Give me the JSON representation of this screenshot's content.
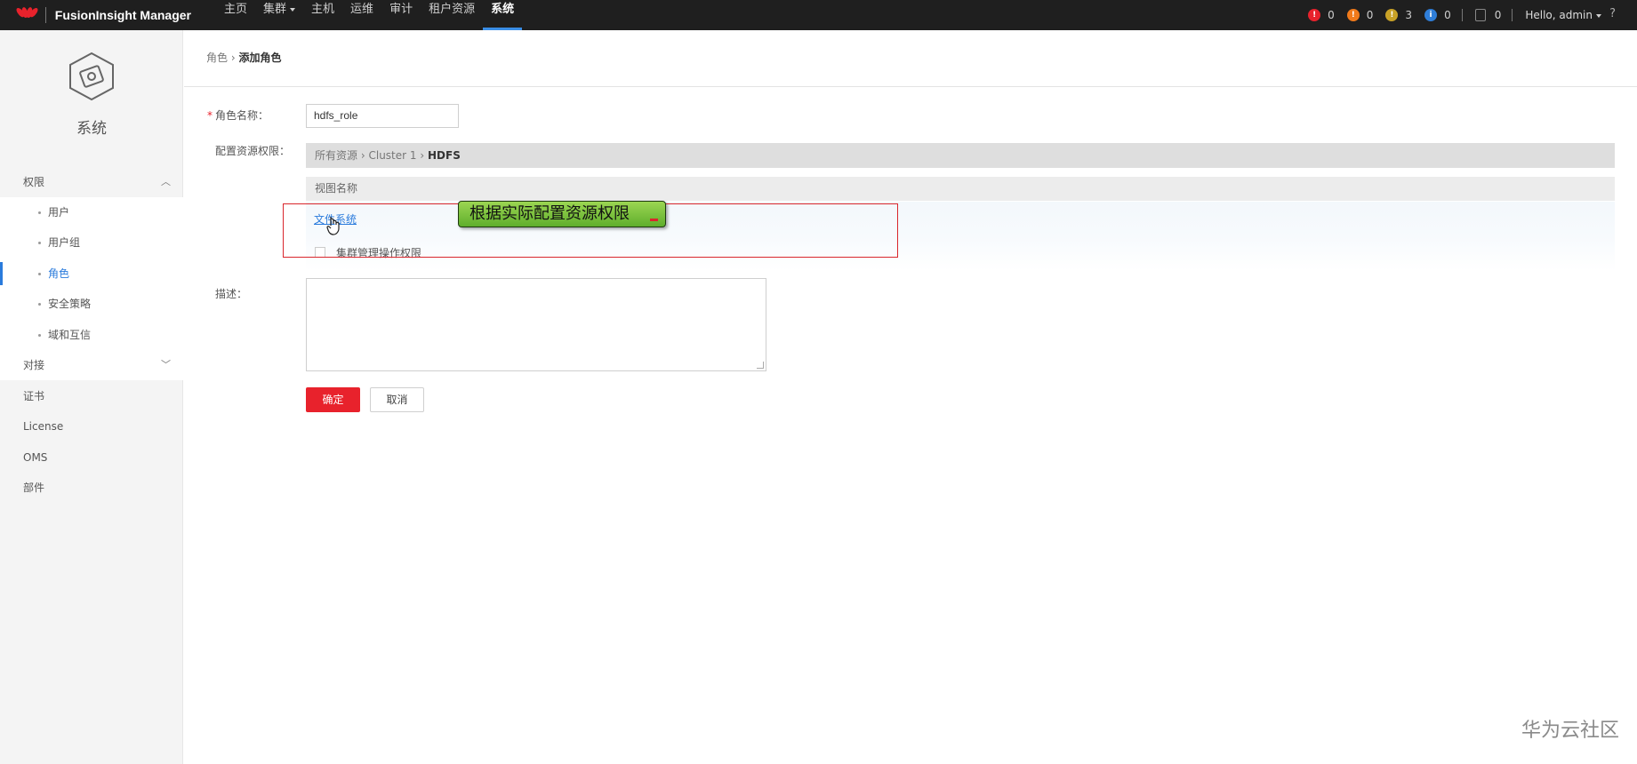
{
  "app": {
    "brand_small": "HUAWEI",
    "title": "FusionInsight Manager"
  },
  "nav": {
    "items": [
      {
        "label": "主页"
      },
      {
        "label": "集群"
      },
      {
        "label": "主机"
      },
      {
        "label": "运维"
      },
      {
        "label": "审计"
      },
      {
        "label": "租户资源"
      },
      {
        "label": "系统"
      }
    ],
    "active": "系统"
  },
  "alarms": {
    "critical": "0",
    "major": "0",
    "minor": "3",
    "warning": "0",
    "tasks": "0",
    "colors": {
      "critical": "#e8222c",
      "major": "#f07a1a",
      "minor": "#c9a227",
      "warning": "#2f7ed8"
    }
  },
  "user": {
    "greeting": "Hello, admin",
    "help": "?"
  },
  "sidebar": {
    "title": "系统",
    "groups": [
      {
        "label": "权限",
        "expanded": true
      },
      {
        "label": "对接",
        "expanded": false
      }
    ],
    "permission_items": [
      "用户",
      "用户组",
      "角色",
      "安全策略",
      "域和互信"
    ],
    "active": "角色",
    "items": [
      "证书",
      "License",
      "OMS",
      "部件"
    ]
  },
  "breadcrumb": {
    "parent": "角色",
    "separator": "›",
    "current": "添加角色"
  },
  "form": {
    "role_name_label": "角色名称：",
    "role_name_value": "hdfs_role",
    "resource_label": "配置资源权限：",
    "resource_path": {
      "root": "所有资源",
      "cluster": "Cluster 1",
      "service": "HDFS",
      "sep": "›"
    },
    "view_header": "视图名称",
    "file_system_link": "文件系统",
    "cluster_admin_label": "集群管理操作权限",
    "description_label": "描述：",
    "ok_label": "确定",
    "cancel_label": "取消"
  },
  "annotation": {
    "callout": "根据实际配置资源权限",
    "box_color": "#d9262c"
  },
  "watermark": "华为云社区",
  "accent_color": "#2a7bdc",
  "primary_color": "#e8222c"
}
